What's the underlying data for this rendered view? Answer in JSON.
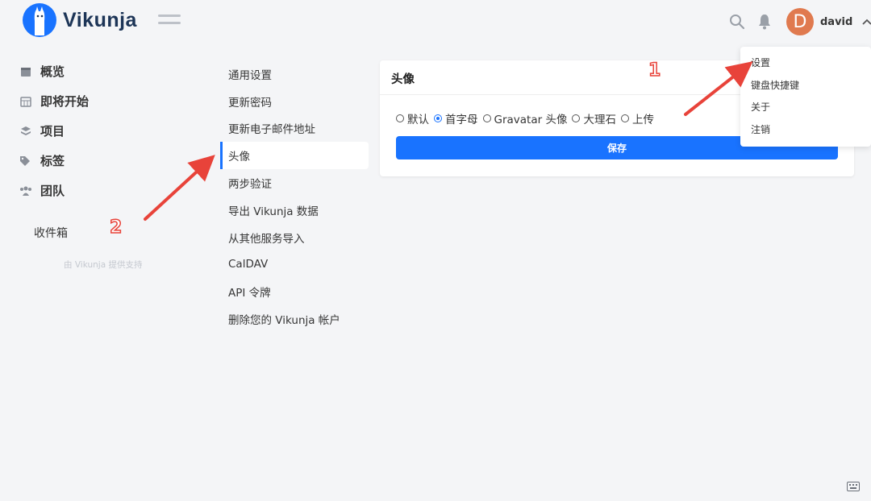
{
  "app": {
    "name": "Vikunja"
  },
  "header": {
    "user": {
      "initial": "D",
      "name": "david"
    }
  },
  "sidebar": {
    "items": [
      {
        "label": "概览",
        "icon": "calendar-icon"
      },
      {
        "label": "即将开始",
        "icon": "calendar-grid-icon"
      },
      {
        "label": "项目",
        "icon": "layers-icon"
      },
      {
        "label": "标签",
        "icon": "tags-icon"
      },
      {
        "label": "团队",
        "icon": "users-icon"
      }
    ],
    "inbox": "收件箱",
    "powered_by": "由 Vikunja 提供支持"
  },
  "settings_nav": {
    "items": [
      "通用设置",
      "更新密码",
      "更新电子邮件地址",
      "头像",
      "两步验证",
      "导出 Vikunja 数据",
      "从其他服务导入",
      "CalDAV",
      "API 令牌",
      "删除您的 Vikunja 帐户"
    ],
    "active": "头像"
  },
  "avatar_card": {
    "title": "头像",
    "options": [
      "默认",
      "首字母",
      "Gravatar 头像",
      "大理石",
      "上传"
    ],
    "selected": "首字母",
    "save_label": "保存"
  },
  "user_dropdown": {
    "items": [
      "设置",
      "键盘快捷键",
      "关于",
      "注销"
    ]
  },
  "annotations": {
    "one": "1",
    "two": "2"
  },
  "colors": {
    "primary": "#1973ff",
    "avatar_bg": "#e07a4f",
    "annotation": "#e8433a"
  }
}
